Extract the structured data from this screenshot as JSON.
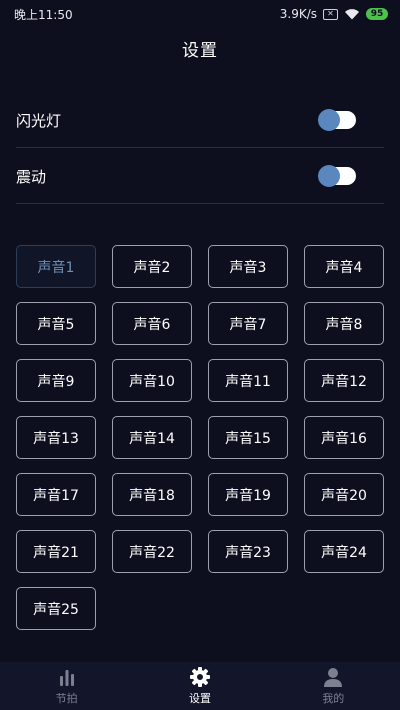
{
  "status_bar": {
    "time": "晚上11:50",
    "speed": "3.9K/s",
    "sim_icon": "sim-x-icon",
    "sim_text": "✕",
    "wifi_icon": "wifi-icon",
    "battery": "95",
    "battery_color": "#4cc24d"
  },
  "header": {
    "title": "设置"
  },
  "settings": [
    {
      "label": "闪光灯",
      "enabled": true
    },
    {
      "label": "震动",
      "enabled": true
    }
  ],
  "sounds": {
    "selected": "声音1",
    "items": [
      "声音1",
      "声音2",
      "声音3",
      "声音4",
      "声音5",
      "声音6",
      "声音7",
      "声音8",
      "声音9",
      "声音10",
      "声音11",
      "声音12",
      "声音13",
      "声音14",
      "声音15",
      "声音16",
      "声音17",
      "声音18",
      "声音19",
      "声音20",
      "声音21",
      "声音22",
      "声音23",
      "声音24",
      "声音25"
    ]
  },
  "bottom_nav": {
    "items": [
      {
        "label": "节拍",
        "icon": "bar-chart-icon",
        "active": false
      },
      {
        "label": "设置",
        "icon": "gear-icon",
        "active": true
      },
      {
        "label": "我的",
        "icon": "person-icon",
        "active": false
      }
    ]
  },
  "colors": {
    "background": "#0d0f1e",
    "toggle_knob": "#5a87bd",
    "selected_text": "#6f8fb6"
  }
}
